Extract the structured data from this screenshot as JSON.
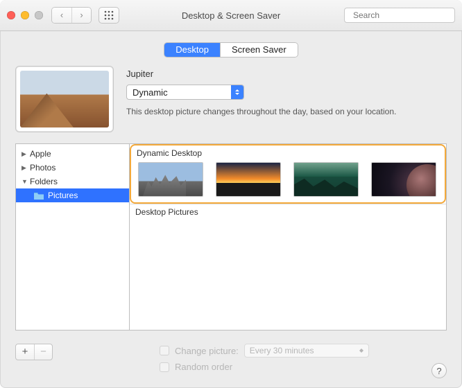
{
  "window": {
    "title": "Desktop & Screen Saver"
  },
  "search": {
    "placeholder": "Search"
  },
  "tabs": {
    "desktop": "Desktop",
    "screensaver": "Screen Saver"
  },
  "current": {
    "name": "Jupiter",
    "mode_label": "Dynamic",
    "hint": "This desktop picture changes throughout the day, based on your location."
  },
  "sidebar": {
    "apple": "Apple",
    "photos": "Photos",
    "folders": "Folders",
    "pictures": "Pictures"
  },
  "groups": {
    "dynamic": "Dynamic Desktop",
    "desktop_pictures": "Desktop Pictures"
  },
  "thumb_names": {
    "t1": "city-skyline",
    "t2": "sunset-field",
    "t3": "forest-mountains",
    "t4": "planet"
  },
  "bottom": {
    "change_picture": "Change picture:",
    "interval": "Every 30 minutes",
    "random": "Random order"
  },
  "help": "?"
}
